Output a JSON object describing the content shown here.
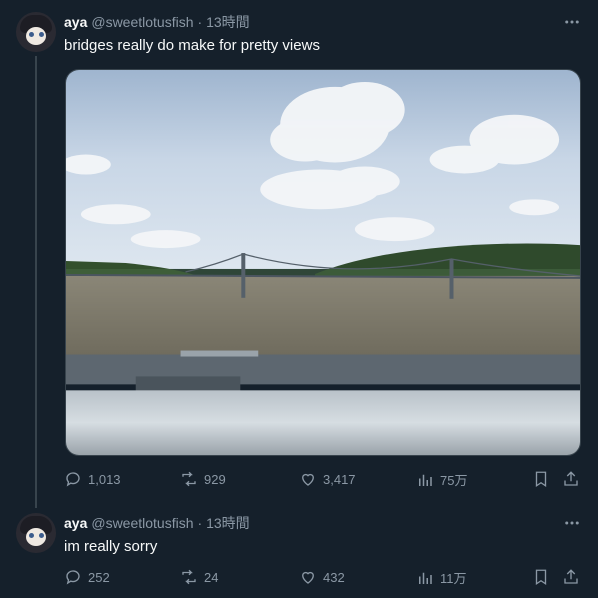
{
  "posts": [
    {
      "display_name": "aya",
      "handle": "@sweetlotusfish",
      "time": "· 13時間",
      "text": "bridges really do make for pretty views",
      "stats": {
        "replies": "1,013",
        "reposts": "929",
        "likes": "3,417",
        "views": "75万"
      }
    },
    {
      "display_name": "aya",
      "handle": "@sweetlotusfish",
      "time": "· 13時間",
      "text": "im really sorry",
      "stats": {
        "replies": "252",
        "reposts": "24",
        "likes": "432",
        "views": "11万"
      }
    }
  ],
  "icons": [
    "more-icon",
    "reply-icon",
    "repost-icon",
    "like-icon",
    "views-icon",
    "bookmark-icon",
    "share-icon"
  ],
  "colors": {
    "background": "#15202b",
    "secondary_text": "#8b98a5",
    "divider": "#38444d"
  }
}
